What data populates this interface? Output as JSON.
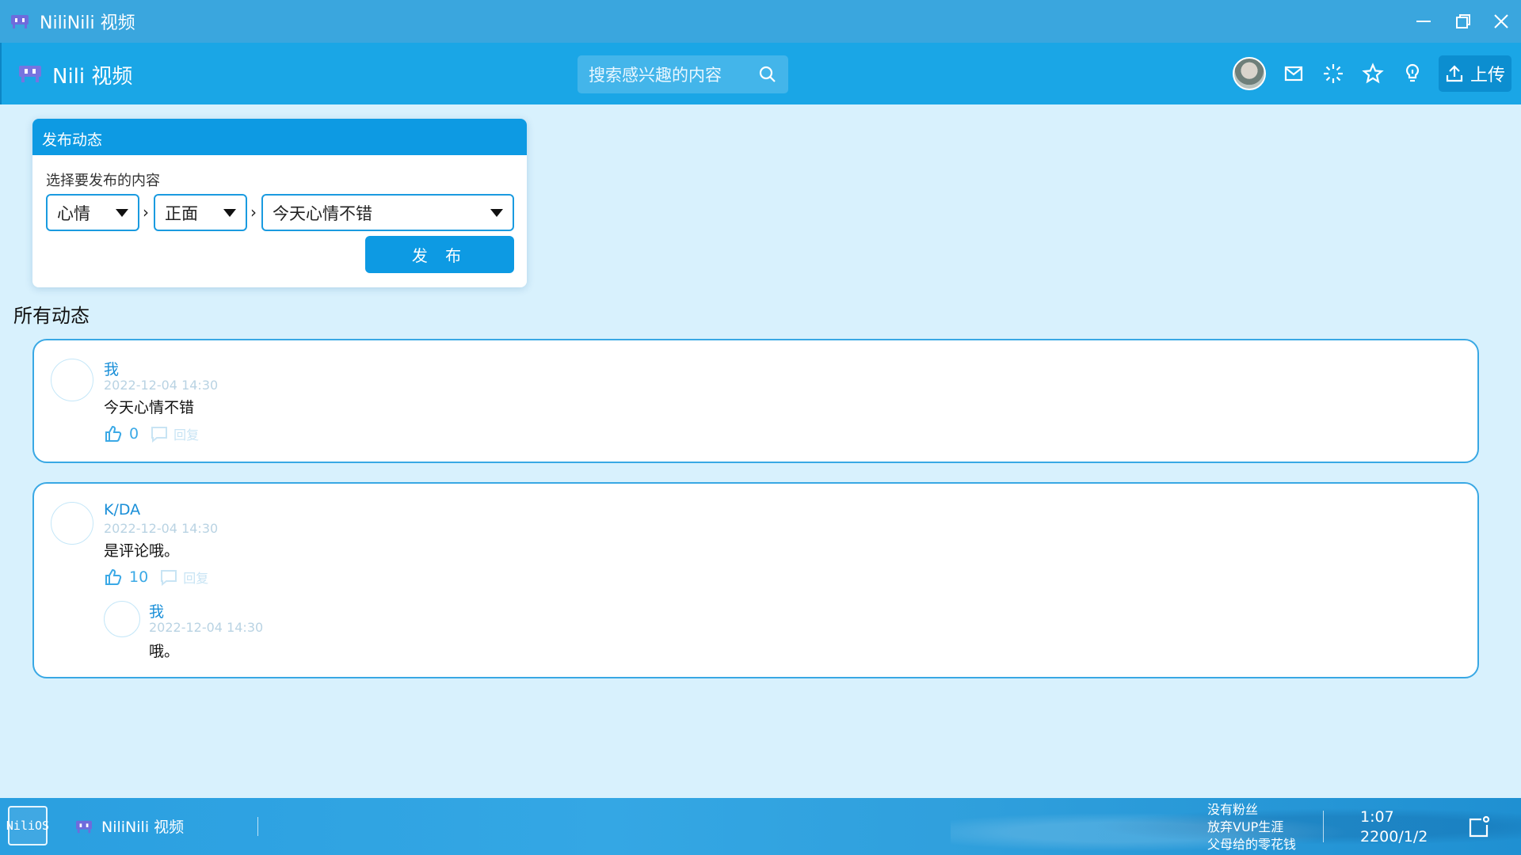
{
  "window": {
    "title": "NiliNili 视频"
  },
  "header": {
    "logo_text": "Nili 视频",
    "search_placeholder": "搜索感兴趣的内容",
    "upload_label": "上传",
    "icons": [
      "mail-icon",
      "loading-icon",
      "star-icon",
      "bulb-icon",
      "upload-icon"
    ]
  },
  "publish": {
    "title": "发布动态",
    "label": "选择要发布的内容",
    "select1": "心情",
    "select2": "正面",
    "select3": "今天心情不错",
    "separator": "›",
    "button": "发 布"
  },
  "section_title": "所有动态",
  "posts": [
    {
      "user": "我",
      "time": "2022-12-04 14:30",
      "content": "今天心情不错",
      "likes": "0",
      "reply_label": "回复"
    },
    {
      "user": "K/DA",
      "time": "2022-12-04 14:30",
      "content": "是评论哦。",
      "likes": "10",
      "reply_label": "回复",
      "replies": [
        {
          "user": "我",
          "time": "2022-12-04 14:30",
          "content": "哦。"
        }
      ]
    }
  ],
  "taskbar": {
    "start_label": "NiliOS",
    "app_label": "NiliNili 视频",
    "marquee": [
      "没有粉丝",
      "放弃VUP生涯",
      "父母给的零花钱"
    ],
    "time": "1:07",
    "date": "2200/1/2"
  },
  "colors": {
    "accent": "#0d9ae3",
    "header": "#1aa6e6",
    "titlebar": "#3aa6de",
    "background": "#d8f1fd"
  }
}
